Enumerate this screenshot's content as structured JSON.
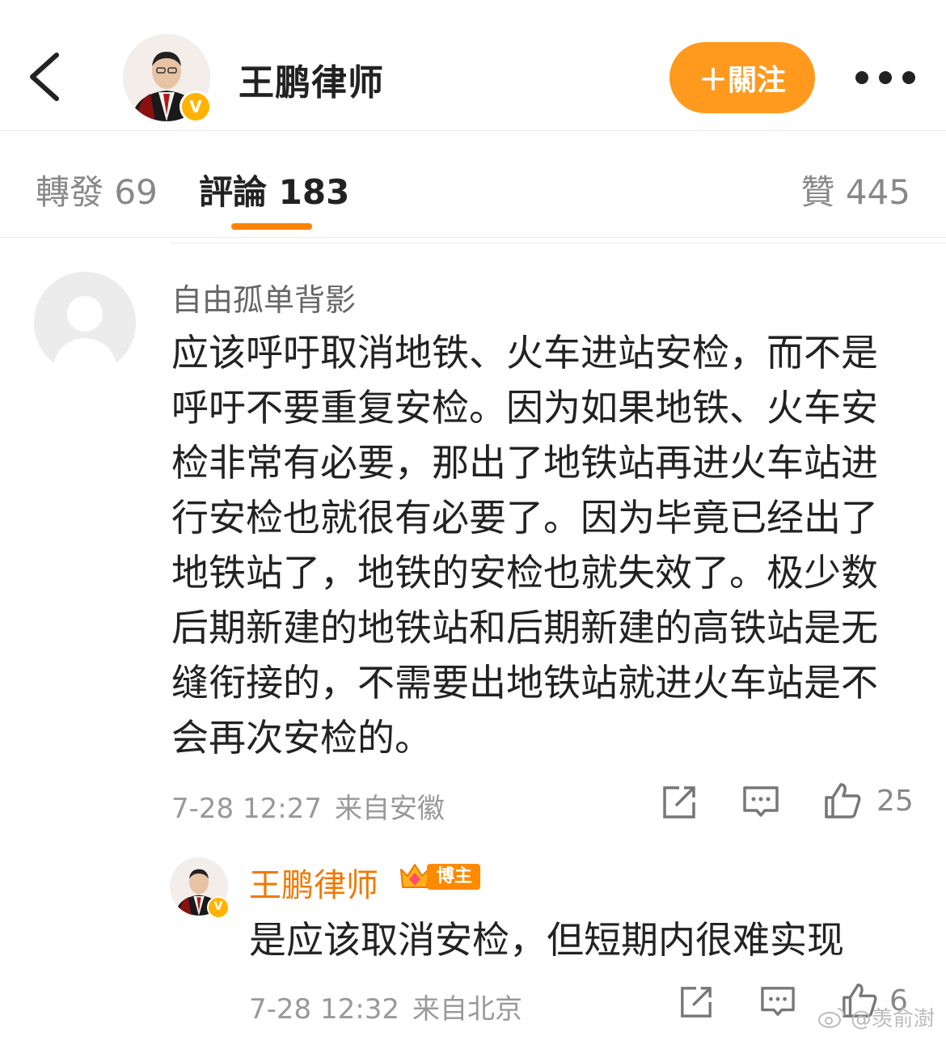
{
  "header": {
    "title": "王鹏律师",
    "follow_label": "＋關注",
    "verified_mark": "V",
    "icons": {
      "back": "back-chevron-icon",
      "more": "more-dots-icon"
    }
  },
  "tabs": {
    "repost": "轉發 69",
    "comment": "評論 183",
    "like": "贊 445",
    "active": "comment"
  },
  "comment": {
    "author": "自由孤单背影",
    "text": "应该呼吁取消地铁、火车进站安检，而不是呼吁不要重复安检。因为如果地铁、火车安检非常有必要，那出了地铁站再进火车站进行安检也就很有必要了。因为毕竟已经出了地铁站了，地铁的安检也就失效了。极少数后期新建的地铁站和后期新建的高铁站是无缝衔接的，不需要出地铁站就进火车站是不会再次安检的。",
    "time": "7-28 12:27",
    "source": "来自安徽",
    "likes": "25"
  },
  "reply": {
    "author": "王鹏律师",
    "badge": "博主",
    "text": "是应该取消安检，但短期内很难实现",
    "time": "7-28 12:32",
    "source": "来自北京",
    "likes": "6"
  },
  "watermark": "@羡俞澍",
  "colors": {
    "accent": "#ff8200",
    "follow": "#ff9a1e",
    "reply_name": "#f07800",
    "verified": "#ffb300"
  }
}
